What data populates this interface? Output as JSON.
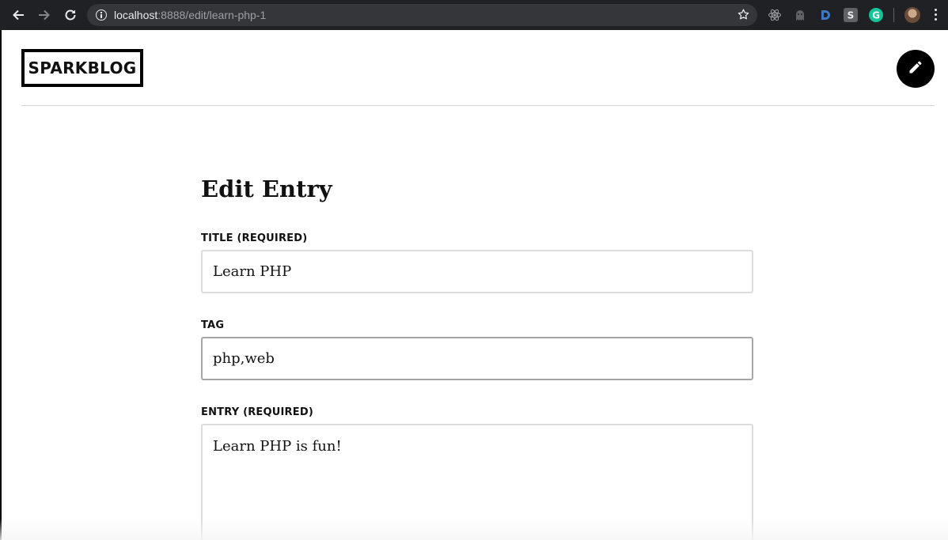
{
  "browser": {
    "url_host": "localhost",
    "url_path": ":8888/edit/learn-php-1",
    "icons": [
      "back-icon",
      "forward-icon",
      "reload-icon",
      "info-icon",
      "bookmark-star-icon",
      "react-devtools-icon",
      "ghost-extension-icon",
      "dashlane-icon",
      "s-extension-icon",
      "grammarly-icon",
      "profile-avatar",
      "menu-kebab-icon"
    ]
  },
  "header": {
    "logo": "SPARKBLOG",
    "edit_icon": "pencil-icon"
  },
  "form": {
    "heading": "Edit Entry",
    "title_label": "TITLE (REQUIRED)",
    "title_value": "Learn PHP",
    "tag_label": "TAG",
    "tag_value": "php,web",
    "entry_label": "ENTRY (REQUIRED)",
    "entry_value": "Learn PHP is fun!"
  },
  "colors": {
    "chrome_bg": "#202124",
    "omnibox_bg": "#35363a",
    "accent": "#000000",
    "field_border": "#dcdcdc"
  }
}
